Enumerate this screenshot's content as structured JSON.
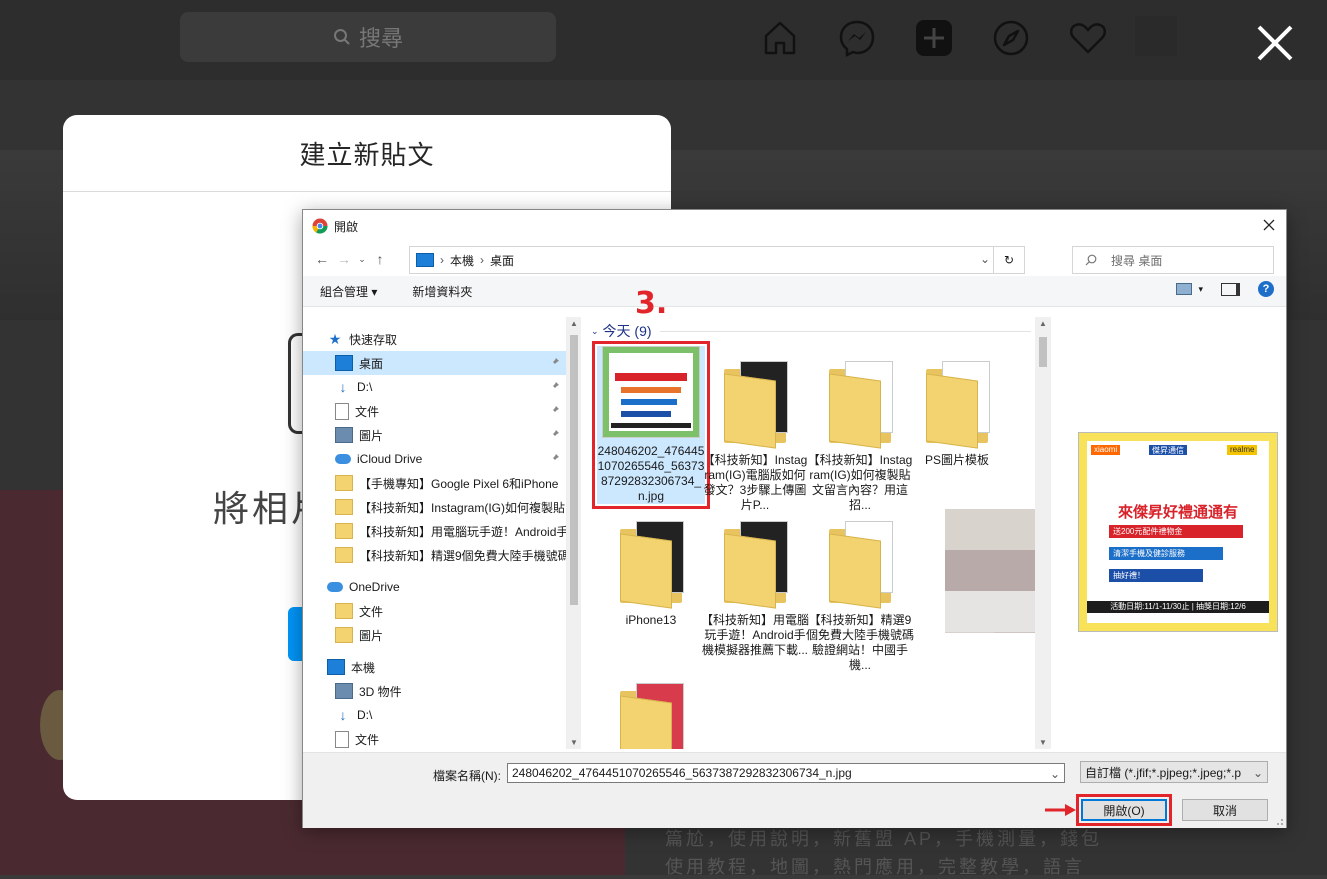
{
  "instagram": {
    "search_placeholder": "搜尋",
    "create_title": "建立新貼文",
    "drag_text": "將相片",
    "bg_text_line1": "篇尬，使用說明，新舊盟 AP，手機測量，錢包",
    "bg_text_line2": "使用教程，地圖，熱門應用，完整教學，語言"
  },
  "dialog": {
    "title": "開啟",
    "breadcrumb": [
      "本機",
      "桌面"
    ],
    "search_placeholder": "搜尋 桌面",
    "toolbar": {
      "organize": "組合管理",
      "new_folder": "新增資料夾"
    },
    "nav_items": [
      {
        "label": "快速存取",
        "icon": "star-icon",
        "indent": 1,
        "pin": false,
        "selected": false
      },
      {
        "label": "桌面",
        "icon": "desktop-icon",
        "indent": 2,
        "pin": true,
        "selected": true
      },
      {
        "label": "D:\\",
        "icon": "download-arrow-icon",
        "indent": 2,
        "pin": true,
        "selected": false
      },
      {
        "label": "文件",
        "icon": "document-icon",
        "indent": 2,
        "pin": true,
        "selected": false
      },
      {
        "label": "圖片",
        "icon": "picture-icon",
        "indent": 2,
        "pin": true,
        "selected": false
      },
      {
        "label": "iCloud Drive",
        "icon": "icloud-icon",
        "indent": 2,
        "pin": true,
        "selected": false
      },
      {
        "label": "【手機專知】Google Pixel 6和iPhone",
        "icon": "folder-icon",
        "indent": 2,
        "pin": false,
        "selected": false
      },
      {
        "label": "【科技新知】Instagram(IG)如何複製貼",
        "icon": "folder-icon",
        "indent": 2,
        "pin": false,
        "selected": false
      },
      {
        "label": "【科技新知】用電腦玩手遊！Android手",
        "icon": "folder-icon",
        "indent": 2,
        "pin": false,
        "selected": false
      },
      {
        "label": "【科技新知】精選9個免費大陸手機號碼",
        "icon": "folder-icon",
        "indent": 2,
        "pin": false,
        "selected": false
      },
      {
        "label": "OneDrive",
        "icon": "onedrive-cloud-icon",
        "indent": 1,
        "pin": false,
        "selected": false
      },
      {
        "label": "文件",
        "icon": "folder-icon",
        "indent": 2,
        "pin": false,
        "selected": false
      },
      {
        "label": "圖片",
        "icon": "folder-icon",
        "indent": 2,
        "pin": false,
        "selected": false
      },
      {
        "label": "本機",
        "icon": "computer-icon",
        "indent": 1,
        "pin": false,
        "selected": false
      },
      {
        "label": "3D 物件",
        "icon": "3d-objects-icon",
        "indent": 2,
        "pin": false,
        "selected": false
      },
      {
        "label": "D:\\",
        "icon": "download-arrow-icon",
        "indent": 2,
        "pin": false,
        "selected": false
      },
      {
        "label": "文件",
        "icon": "document-icon",
        "indent": 2,
        "pin": false,
        "selected": false
      }
    ],
    "group_header": "今天 (9)",
    "step_label": "3.",
    "files": [
      {
        "name": "248046202_4764451070265546_5637387292832306734_n.jpg",
        "kind": "image",
        "selected": true
      },
      {
        "name": "【科技新知】Instagram(IG)電腦版如何發文？3步驟上傳圖片P...",
        "kind": "folder",
        "selected": false
      },
      {
        "name": "【科技新知】Instagram(IG)如何複製貼文留言內容？用這招...",
        "kind": "folder",
        "selected": false
      },
      {
        "name": "PS圖片模板",
        "kind": "folder",
        "selected": false
      },
      {
        "name": "iPhone13",
        "kind": "folder",
        "selected": false
      },
      {
        "name": "【科技新知】用電腦玩手遊！Android手機模擬器推薦下載...",
        "kind": "folder",
        "selected": false
      },
      {
        "name": "【科技新知】精選9個免費大陸手機號碼驗證網站！中國手機...",
        "kind": "folder",
        "selected": false
      },
      {
        "name": "",
        "kind": "blurred",
        "selected": false
      },
      {
        "name": "",
        "kind": "folder",
        "selected": false
      }
    ],
    "preview": {
      "brand_left": "xiaomi",
      "brand_mid": "傑昇通信",
      "brand_right": "realme",
      "headline": "來傑昇好禮通通有",
      "bar1": "送200元配件禮物金",
      "bar2": "清潔手機及健診服務",
      "bar3": "抽好禮！",
      "dates": "活動日期:11/1-11/30止 | 抽獎日期:12/6"
    },
    "filename_label": "檔案名稱(N):",
    "filename_value": "248046202_4764451070265546_5637387292832306734_n.jpg",
    "filter_value": "自訂檔 (*.jfif;*.pjpeg;*.jpeg;*.p",
    "open_button": "開啟(O)",
    "cancel_button": "取消"
  },
  "colors": {
    "highlight_red": "#e1252a",
    "selection_blue": "#cce8ff",
    "accent_blue": "#0078d7"
  }
}
